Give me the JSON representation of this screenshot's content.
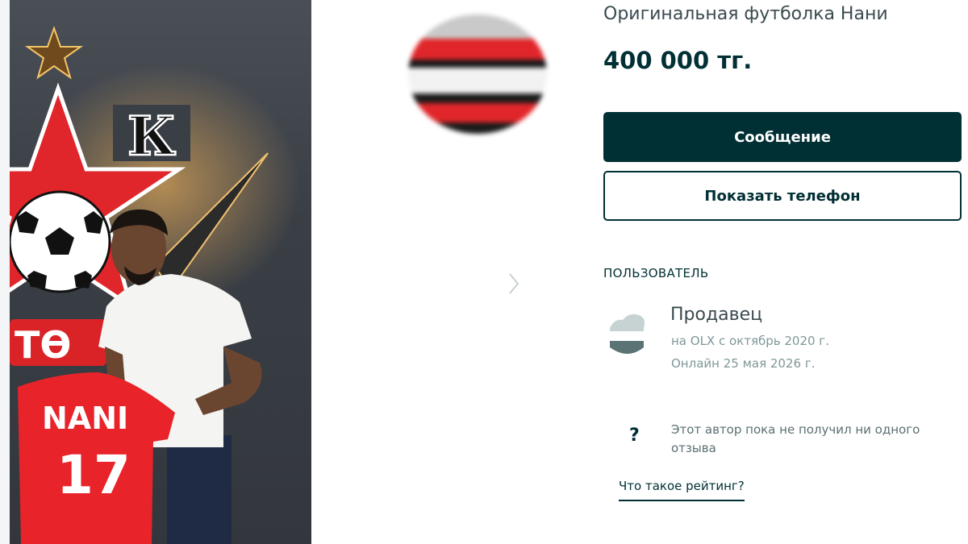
{
  "listing": {
    "title": "Оригинальная футболка Нани",
    "price": "400 000 тг."
  },
  "actions": {
    "message_label": "Сообщение",
    "phone_label": "Показать телефон"
  },
  "photo": {
    "club_letter": "К",
    "club_text": "ТӨ",
    "jersey_name": "NANI",
    "jersey_number": "17"
  },
  "user": {
    "section_label": "ПОЛЬЗОВАТЕЛЬ",
    "name": "Продавец",
    "since": "на OLX с октябрь 2020 г.",
    "online": "Онлайн 25 мая 2026 г."
  },
  "reviews": {
    "icon": "question-icon",
    "glyph": "?",
    "text": "Этот автор пока не получил ни одного отзыва",
    "rating_link": "Что такое рейтинг?"
  },
  "colors": {
    "primary": "#002f34",
    "muted": "#7f9799",
    "club_red": "#e0262a"
  }
}
